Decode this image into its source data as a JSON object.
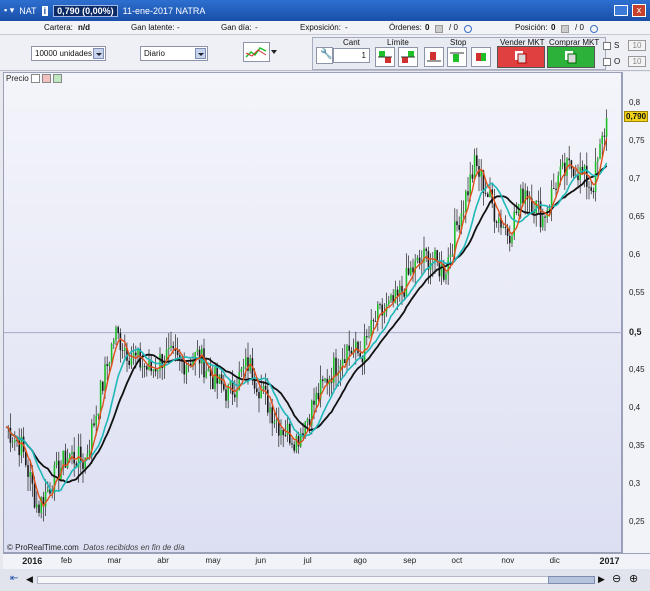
{
  "titlebar": {
    "symbol": "NAT",
    "price_change": "0,790 (0,00%)",
    "date_name": "11-ene-2017 NATRA",
    "close_label": "x"
  },
  "infobar": {
    "cartera_label": "Cartera:",
    "cartera_value": "n/d",
    "gan_latente_label": "Gan latente:",
    "gan_latente_value": "-",
    "gan_dia_label": "Gan día:",
    "gan_dia_value": "-",
    "exposicion_label": "Exposición:",
    "exposicion_value": "-",
    "ordenes_label": "Órdenes:",
    "ordenes_value_1": "0",
    "ordenes_value_2": "/ 0",
    "posicion_label": "Posición:",
    "posicion_value_1": "0",
    "posicion_value_2": "/ 0"
  },
  "toolbar": {
    "units": "10000 unidades",
    "period": "Diario",
    "cant_label": "Cant",
    "quantity": "1",
    "limite_label": "Límite",
    "stop_label": "Stop",
    "sell_label": "Vender MKT",
    "buy_label": "Comprar MKT",
    "side_s_label": "S",
    "side_s_value": "10",
    "side_o_label": "O",
    "side_o_value": "10"
  },
  "chart_data": {
    "type": "line",
    "legend_label": "Precio",
    "credit": "© ProRealTime.com",
    "credit_note": "Datos recibidos en fin de día",
    "last_price": "0,790",
    "y_ticks": [
      "0,8",
      "0,75",
      "0,7",
      "0,65",
      "0,6",
      "0,55",
      "0,5",
      "0,45",
      "0,4",
      "0,35",
      "0,3",
      "0,25"
    ],
    "x_ticks": [
      "2016",
      "feb",
      "mar",
      "abr",
      "may",
      "jun",
      "jul",
      "ago",
      "sep",
      "oct",
      "nov",
      "dic",
      "2017"
    ],
    "ylim": [
      0.21,
      0.84
    ],
    "colors": {
      "up": "#1fbf2a",
      "down": "#1a1a1a",
      "ma_fast": "#e0501a",
      "ma_mid": "#1fb8b8",
      "ma_slow": "#111111"
    },
    "series": [
      {
        "name": "Precio",
        "x": [
          "2016-01-01",
          "2016-01-12",
          "2016-01-22",
          "2016-02-01",
          "2016-02-10",
          "2016-02-20",
          "2016-03-01",
          "2016-03-10",
          "2016-03-20",
          "2016-04-01",
          "2016-04-10",
          "2016-04-20",
          "2016-05-01",
          "2016-05-10",
          "2016-05-20",
          "2016-06-01",
          "2016-06-10",
          "2016-06-20",
          "2016-07-01",
          "2016-07-10",
          "2016-07-20",
          "2016-08-01",
          "2016-08-10",
          "2016-08-20",
          "2016-09-01",
          "2016-09-10",
          "2016-09-20",
          "2016-10-01",
          "2016-10-10",
          "2016-10-20",
          "2016-11-01",
          "2016-11-10",
          "2016-11-20",
          "2016-12-01",
          "2016-12-10",
          "2016-12-20",
          "2017-01-01",
          "2017-01-11"
        ],
        "values": [
          0.38,
          0.35,
          0.27,
          0.31,
          0.34,
          0.33,
          0.42,
          0.5,
          0.47,
          0.45,
          0.47,
          0.46,
          0.47,
          0.44,
          0.42,
          0.46,
          0.42,
          0.38,
          0.36,
          0.4,
          0.44,
          0.48,
          0.47,
          0.52,
          0.54,
          0.58,
          0.6,
          0.58,
          0.65,
          0.72,
          0.66,
          0.63,
          0.69,
          0.65,
          0.7,
          0.72,
          0.69,
          0.79
        ]
      }
    ]
  }
}
